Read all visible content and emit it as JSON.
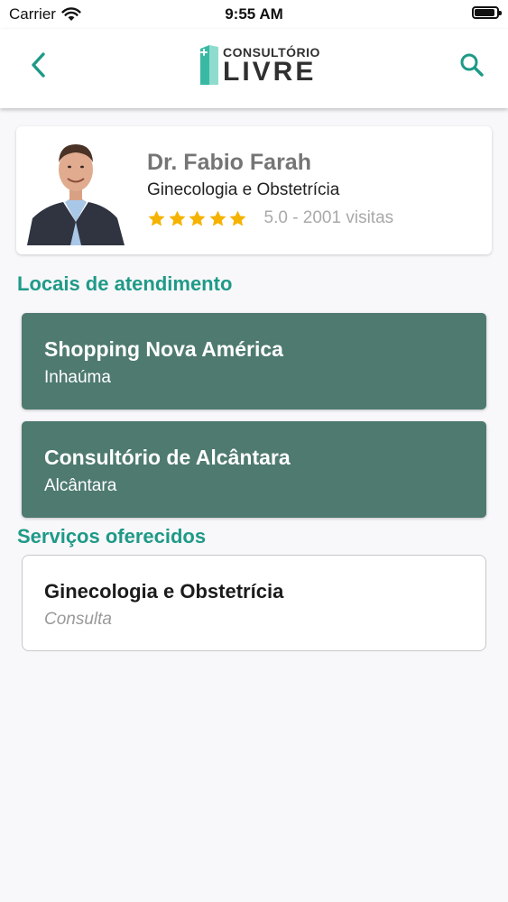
{
  "status_bar": {
    "carrier": "Carrier",
    "time": "9:55 AM",
    "battery_level": 0.9
  },
  "navbar": {
    "logo_top": "CONSULTÓRIO",
    "logo_bottom": "LIVRE",
    "brand_color": "#1e9a87"
  },
  "doctor": {
    "name": "Dr. Fabio Farah",
    "specialty": "Ginecologia e Obstetrícia",
    "stars": 5,
    "rating_text": "5.0 - 2001 visitas"
  },
  "locations_section": {
    "title": "Locais de atendimento",
    "items": [
      {
        "name": "Shopping Nova América",
        "area": "Inhaúma"
      },
      {
        "name": "Consultório de Alcântara",
        "area": "Alcântara"
      }
    ]
  },
  "services_section": {
    "title": "Serviços oferecidos",
    "items": [
      {
        "name": "Ginecologia e Obstetrícia",
        "type": "Consulta"
      }
    ]
  },
  "colors": {
    "accent": "#1e9a87",
    "location_card": "#4e7a6f",
    "star": "#f5b300"
  }
}
